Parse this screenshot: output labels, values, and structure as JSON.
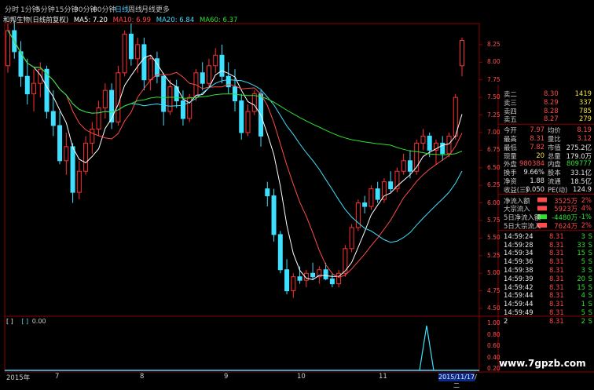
{
  "tabs": [
    {
      "label": "分时",
      "active": false
    },
    {
      "label": "1分钟",
      "active": false
    },
    {
      "label": "5分钟",
      "active": false
    },
    {
      "label": "15分钟",
      "active": false
    },
    {
      "label": "30分钟",
      "active": false
    },
    {
      "label": "60分钟",
      "active": false
    },
    {
      "label": "日线",
      "active": true
    },
    {
      "label": "周线",
      "active": false
    },
    {
      "label": "月线",
      "active": false
    },
    {
      "label": "更多",
      "active": false
    }
  ],
  "stock_title": "和邦生物(日线前复权)",
  "ma": [
    {
      "label": "MA5: 7.20",
      "color": "#ffffff"
    },
    {
      "label": "MA10: 6.99",
      "color": "#ff4b4b"
    },
    {
      "label": "MA20: 6.84",
      "color": "#3fe0ff"
    },
    {
      "label": "MA60: 6.37",
      "color": "#30e030"
    }
  ],
  "price_axis": [
    "8.25",
    "8.00",
    "7.75",
    "7.50",
    "7.25",
    "7.00",
    "6.75",
    "6.50",
    "6.25",
    "6.00",
    "5.75",
    "5.50",
    "5.25",
    "5.00",
    "4.75",
    "4.50"
  ],
  "sub_axis": [
    "1.00",
    "0.80",
    "0.60",
    "0.40",
    "0.20"
  ],
  "indicator": {
    "label1": "[ ]",
    "label2": "[ ]",
    "value": "0.00"
  },
  "dates": [
    "2015年",
    "7",
    "8",
    "9",
    "10",
    "11"
  ],
  "cursor_date": "2015/11/17/二",
  "order_book": [
    {
      "label": "卖二",
      "price": "8.30",
      "vol": "1419"
    },
    {
      "label": "卖三",
      "price": "8.29",
      "vol": "337"
    },
    {
      "label": "卖四",
      "price": "8.28",
      "vol": "785"
    },
    {
      "label": "卖五",
      "price": "8.27",
      "vol": "279"
    }
  ],
  "quote_rows": [
    {
      "l1": "今开",
      "v1": "7.97",
      "c1": "red",
      "l2": "均价",
      "v2": "8.19",
      "c2": "red"
    },
    {
      "l1": "最高",
      "v1": "8.31",
      "c1": "red",
      "l2": "量比",
      "v2": "3.12",
      "c2": "red"
    },
    {
      "l1": "最低",
      "v1": "7.82",
      "c1": "red",
      "l2": "市值",
      "v2": "275.2亿",
      "c2": "white"
    },
    {
      "l1": "现量",
      "v1": "20",
      "c1": "yellow",
      "l2": "总量",
      "v2": "179.0万",
      "c2": "white"
    },
    {
      "l1": "外盘",
      "v1": "980384",
      "c1": "red",
      "l2": "内盘",
      "v2": "809777",
      "c2": "green"
    },
    {
      "l1": "换手",
      "v1": "9.66%",
      "c1": "white",
      "l2": "股本",
      "v2": "33.1亿",
      "c2": "white"
    },
    {
      "l1": "净资",
      "v1": "1.88",
      "c1": "white",
      "l2": "流通",
      "v2": "18.5亿",
      "c2": "white"
    },
    {
      "l1": "收益(三)",
      "v1": "0.050",
      "c1": "white",
      "l2": "PE(动)",
      "v2": "124.9",
      "c2": "white"
    }
  ],
  "flow_rows": [
    {
      "label": "净流入额",
      "value": "3525万",
      "pct": "2%",
      "color": "red"
    },
    {
      "label": "大宗流入",
      "value": "5923万",
      "pct": "4%",
      "color": "red"
    },
    {
      "label": "5日净流入额",
      "value": "-4480万",
      "pct": "-1%",
      "color": "green"
    },
    {
      "label": "5日大宗流入",
      "value": "7624万",
      "pct": "2%",
      "color": "red"
    }
  ],
  "ticks": [
    {
      "time": "14:59:24",
      "price": "8.31",
      "vol": "3",
      "side": "S"
    },
    {
      "time": "14:59:28",
      "price": "8.31",
      "vol": "33",
      "side": "S"
    },
    {
      "time": "14:59:34",
      "price": "8.31",
      "vol": "15",
      "side": "S"
    },
    {
      "time": "14:59:36",
      "price": "8.31",
      "vol": "5",
      "side": "S"
    },
    {
      "time": "14:59:38",
      "price": "8.31",
      "vol": "3",
      "side": "S"
    },
    {
      "time": "14:59:39",
      "price": "8.31",
      "vol": "20",
      "side": "S"
    },
    {
      "time": "14:59:42",
      "price": "8.31",
      "vol": "15",
      "side": "S"
    },
    {
      "time": "14:59:44",
      "price": "8.31",
      "vol": "4",
      "side": "S"
    },
    {
      "time": "14:59:44",
      "price": "8.31",
      "vol": "1",
      "side": "S"
    },
    {
      "time": "14:59:49",
      "price": "8.31",
      "vol": "5",
      "side": "S"
    },
    {
      "time": "2",
      "price": "8.31",
      "vol": "2",
      "side": "S"
    }
  ],
  "watermark": "www.7gpzb.com",
  "colors": {
    "up": "#ff3030",
    "down": "#3fe0ff",
    "ma5": "#ffffff",
    "ma10": "#ff4b4b",
    "ma20": "#3fe0ff",
    "ma60": "#30e030",
    "grid": "#8b0000"
  },
  "chart_data": {
    "type": "candlestick",
    "series_ohlc": [
      [
        7.95,
        8.55,
        7.85,
        8.45
      ],
      [
        8.45,
        8.6,
        8.05,
        8.15
      ],
      [
        8.15,
        8.3,
        7.65,
        7.8
      ],
      [
        7.8,
        8.05,
        7.4,
        7.55
      ],
      [
        7.55,
        7.9,
        7.3,
        7.7
      ],
      [
        7.7,
        8.0,
        7.5,
        7.9
      ],
      [
        7.9,
        7.95,
        7.2,
        7.3
      ],
      [
        7.3,
        7.6,
        6.95,
        7.1
      ],
      [
        7.1,
        7.3,
        6.55,
        6.6
      ],
      [
        6.6,
        7.0,
        6.4,
        6.8
      ],
      [
        6.8,
        6.85,
        6.0,
        6.15
      ],
      [
        6.15,
        6.6,
        6.05,
        6.45
      ],
      [
        6.45,
        6.95,
        6.4,
        6.85
      ],
      [
        6.85,
        7.15,
        6.7,
        7.05
      ],
      [
        7.05,
        7.45,
        6.95,
        7.35
      ],
      [
        7.35,
        7.7,
        7.2,
        7.6
      ],
      [
        7.6,
        7.7,
        7.05,
        7.15
      ],
      [
        7.15,
        7.95,
        7.1,
        7.85
      ],
      [
        7.85,
        8.45,
        7.8,
        8.4
      ],
      [
        8.4,
        8.55,
        7.95,
        8.05
      ],
      [
        8.05,
        8.35,
        7.85,
        8.25
      ],
      [
        8.25,
        8.35,
        7.6,
        7.75
      ],
      [
        7.75,
        8.1,
        7.6,
        8.05
      ],
      [
        8.05,
        8.15,
        7.7,
        7.8
      ],
      [
        7.8,
        7.85,
        7.1,
        7.3
      ],
      [
        7.3,
        7.75,
        7.25,
        7.65
      ],
      [
        7.65,
        7.75,
        7.35,
        7.45
      ],
      [
        7.45,
        7.6,
        7.1,
        7.2
      ],
      [
        7.2,
        7.55,
        7.15,
        7.5
      ],
      [
        7.5,
        7.9,
        7.45,
        7.85
      ],
      [
        7.85,
        8.0,
        7.6,
        7.7
      ],
      [
        7.7,
        8.05,
        7.65,
        7.95
      ],
      [
        7.95,
        8.2,
        7.85,
        8.1
      ],
      [
        8.1,
        8.25,
        7.7,
        7.8
      ],
      [
        7.8,
        8.0,
        7.55,
        7.65
      ],
      [
        7.65,
        7.9,
        7.3,
        7.45
      ],
      [
        7.45,
        7.55,
        6.9,
        7.0
      ],
      [
        7.0,
        7.4,
        6.95,
        7.3
      ],
      [
        7.3,
        7.6,
        7.25,
        7.55
      ],
      [
        7.55,
        7.6,
        6.8,
        6.95
      ],
      [
        6.2,
        6.3,
        5.95,
        6.1
      ],
      [
        6.1,
        6.2,
        5.45,
        5.55
      ],
      [
        5.55,
        5.6,
        5.0,
        5.05
      ],
      [
        5.05,
        5.2,
        4.7,
        4.75
      ],
      [
        4.75,
        5.0,
        4.65,
        4.95
      ],
      [
        4.95,
        5.1,
        4.85,
        4.9
      ],
      [
        4.9,
        5.05,
        4.8,
        5.0
      ],
      [
        5.0,
        5.15,
        4.9,
        4.95
      ],
      [
        4.95,
        5.1,
        4.85,
        5.05
      ],
      [
        5.05,
        5.15,
        4.9,
        4.92
      ],
      [
        4.92,
        5.0,
        4.8,
        4.85
      ],
      [
        4.85,
        5.05,
        4.8,
        5.0
      ],
      [
        5.0,
        5.4,
        4.95,
        5.35
      ],
      [
        5.35,
        5.7,
        5.3,
        5.65
      ],
      [
        5.65,
        6.05,
        5.6,
        6.0
      ],
      [
        6.0,
        6.1,
        5.85,
        5.95
      ],
      [
        5.95,
        6.25,
        5.9,
        6.2
      ],
      [
        6.2,
        6.3,
        6.0,
        6.05
      ],
      [
        6.05,
        6.35,
        6.0,
        6.3
      ],
      [
        6.3,
        6.45,
        6.15,
        6.2
      ],
      [
        6.2,
        6.5,
        6.15,
        6.45
      ],
      [
        6.45,
        6.7,
        6.4,
        6.6
      ],
      [
        6.6,
        6.75,
        6.35,
        6.45
      ],
      [
        6.45,
        6.9,
        6.4,
        6.85
      ],
      [
        6.85,
        7.05,
        6.75,
        6.95
      ],
      [
        6.95,
        7.0,
        6.65,
        6.75
      ],
      [
        6.75,
        6.9,
        6.55,
        6.85
      ],
      [
        6.85,
        6.95,
        6.6,
        6.7
      ],
      [
        6.7,
        7.0,
        6.65,
        6.95
      ],
      [
        6.95,
        7.55,
        6.9,
        7.5
      ],
      [
        7.95,
        8.35,
        7.8,
        8.31
      ]
    ],
    "xlabel": "",
    "ylabel": "",
    "ylim": [
      4.4,
      8.55
    ]
  }
}
